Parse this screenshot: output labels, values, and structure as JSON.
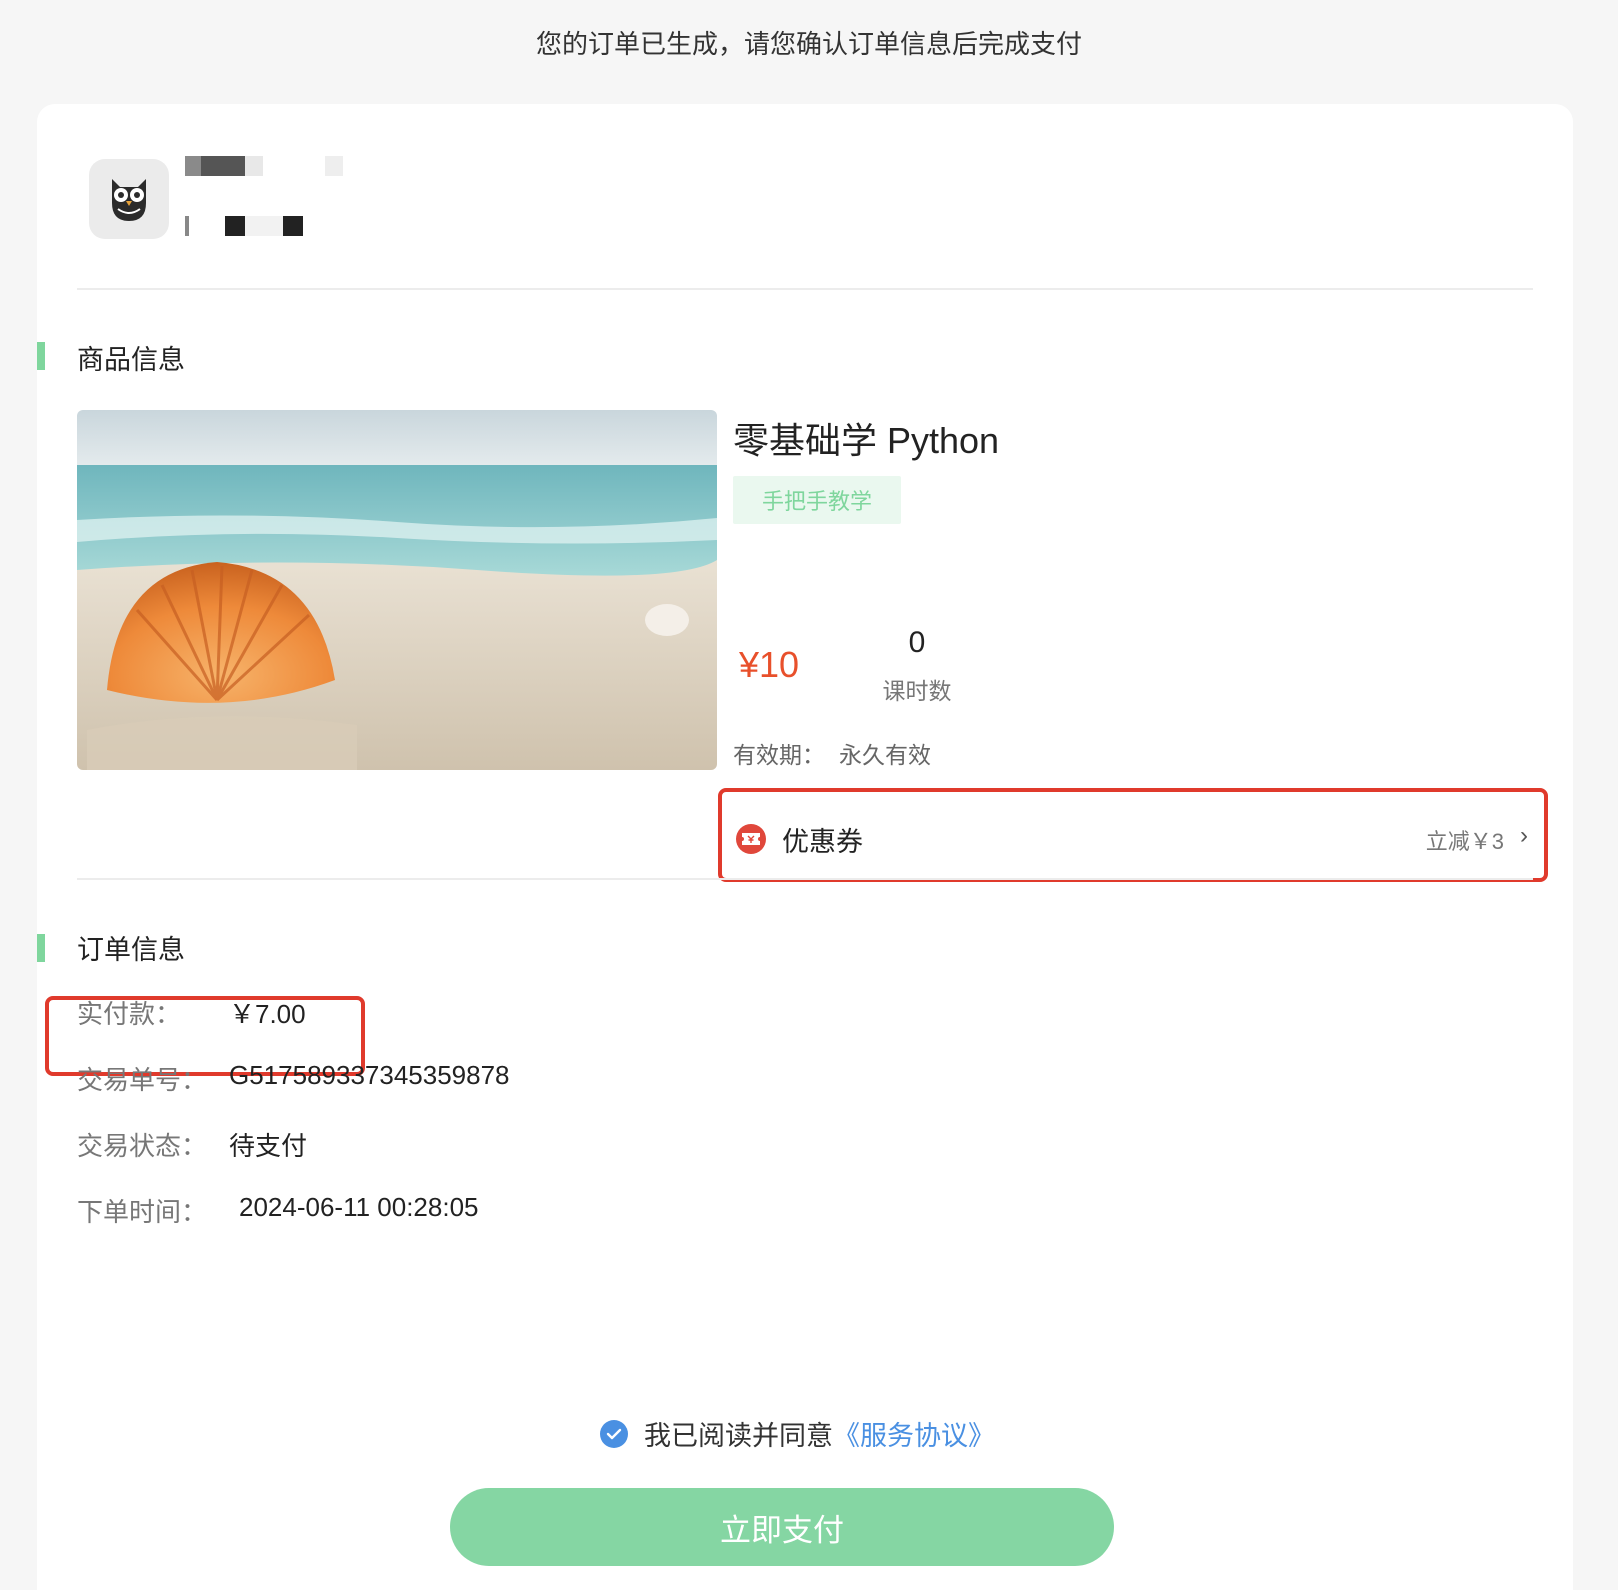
{
  "header": {
    "notice": "您的订单已生成，请您确认订单信息后完成支付"
  },
  "shop": {
    "logo_icon": "owl-logo-icon"
  },
  "product_section": {
    "title": "商品信息",
    "product": {
      "name": "零基础学 Python",
      "tag": "手把手教学",
      "price": "¥10",
      "lesson_count": "0",
      "lesson_label": "课时数",
      "validity_label": "有效期：",
      "validity_value": "永久有效"
    },
    "coupon": {
      "icon": "coupon-ticket-icon",
      "label": "优惠券",
      "value": "立减￥3",
      "chevron": "›"
    }
  },
  "order_section": {
    "title": "订单信息",
    "paid_label": "实付款：",
    "paid_value": "￥7.00",
    "trade_no_label": "交易单号：",
    "trade_no_value": "G5175893373453598​78",
    "status_label": "交易状态：",
    "status_value": "待支付",
    "time_label": "下单时间：",
    "time_value": "2024-06-11 00:28:05"
  },
  "agreement": {
    "text": "我已阅读并同意",
    "link": "《服务协议》",
    "checked": true
  },
  "pay_button": {
    "label": "立即支付"
  },
  "colors": {
    "accent_green": "#85d6a3",
    "price_red": "#e8502b",
    "highlight_red": "#e03a2c",
    "link_blue": "#4a90e2"
  }
}
